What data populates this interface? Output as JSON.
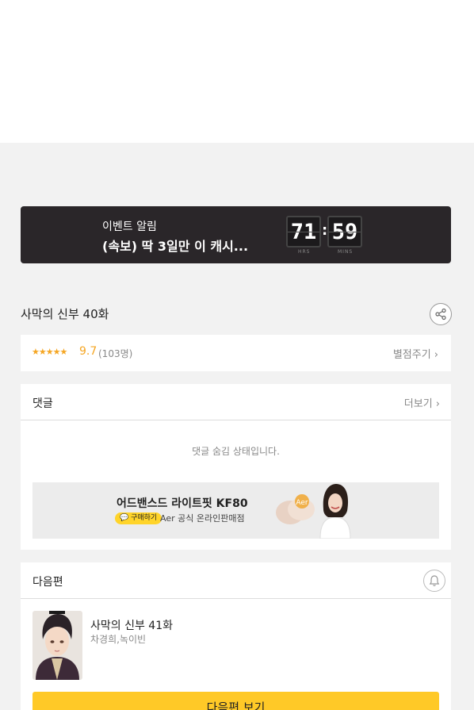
{
  "event": {
    "label": "이벤트 알림",
    "title": "(속보) 딱 3일만 이 캐시...",
    "timer": {
      "hours": "71",
      "minutes": "59",
      "separator": ":",
      "hours_caption": "HRS",
      "minutes_caption": "MINS"
    }
  },
  "episode": {
    "title": "사막의 신부 40화"
  },
  "rating": {
    "stars": "★★★★★",
    "score": "9.7",
    "count": "(103명)",
    "rate_link": "별점주기 ›"
  },
  "comments": {
    "title": "댓글",
    "more_link": "더보기 ›",
    "hidden_message": "댓글 숨김 상태입니다.",
    "ad": {
      "title": "어드밴스드 라이트핏 KF80",
      "badge": "💬 구매하기",
      "subtitle": "Aer 공식 온라인판매점"
    }
  },
  "next_episode": {
    "section_title": "다음편",
    "title": "사막의 신부 41화",
    "authors": "차경희,녹이빈",
    "button_label": "다음편 보기"
  },
  "colors": {
    "accent": "#ffc927",
    "star": "#f5a623",
    "banner_bg": "#2a2629"
  }
}
